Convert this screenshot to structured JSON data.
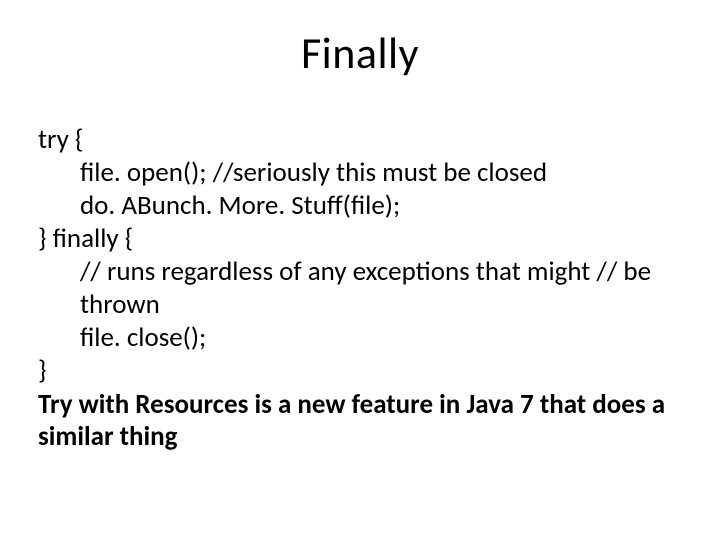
{
  "title": "Finally",
  "code": {
    "l1": "try {",
    "l2": "file. open(); //seriously this must be closed",
    "l3": "do. ABunch. More. Stuff(file);",
    "l4": "} finally {",
    "l5": "// runs regardless of any exceptions that might // be thrown",
    "l6": "file. close();",
    "l7": "}"
  },
  "footer": "Try with Resources is a new feature in Java 7 that does a similar thing"
}
